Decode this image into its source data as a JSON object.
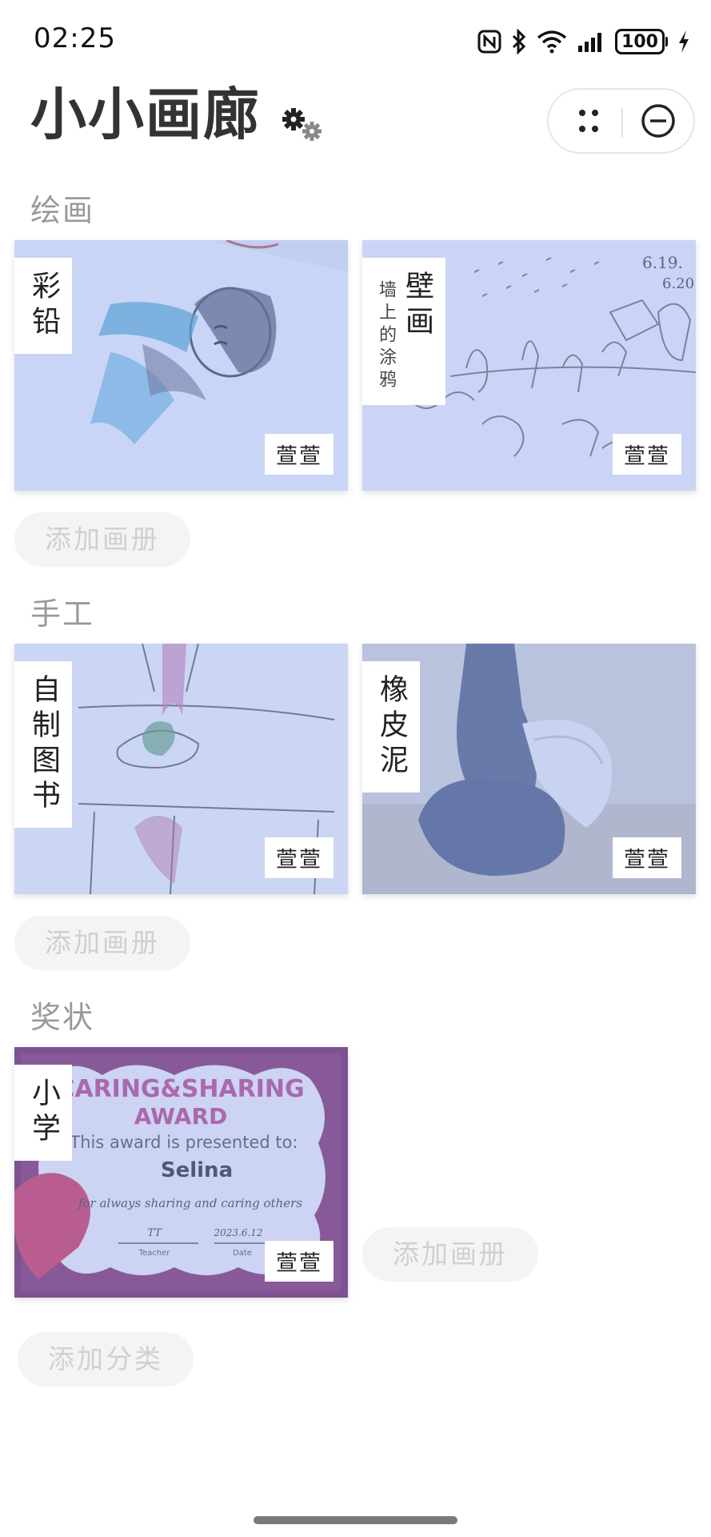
{
  "status": {
    "time": "02:25",
    "battery": "100"
  },
  "header": {
    "title": "小小画廊"
  },
  "sections": [
    {
      "title": "绘画",
      "add_label": "添加画册",
      "albums": [
        {
          "title": "彩铅",
          "subtitle": "",
          "owner": "萱萱"
        },
        {
          "title": "壁画",
          "subtitle": "墙上的涂鸦",
          "owner": "萱萱"
        }
      ]
    },
    {
      "title": "手工",
      "add_label": "添加画册",
      "albums": [
        {
          "title": "自制图书",
          "subtitle": "",
          "owner": "萱萱"
        },
        {
          "title": "橡皮泥",
          "subtitle": "",
          "owner": "萱萱"
        }
      ]
    },
    {
      "title": "奖状",
      "add_label": "添加画册",
      "albums": [
        {
          "title": "小学",
          "subtitle": "",
          "owner": "萱萱"
        }
      ]
    }
  ],
  "add_category_label": "添加分类",
  "certificate": {
    "heading1": "CARING&SHARING",
    "heading2": "AWARD",
    "line": "This award is presented to:",
    "name": "Selina",
    "reason": "for always sharing and caring others",
    "sign": "TT",
    "date": "2023.6.12",
    "teacher_label": "Teacher",
    "date_label": "Date"
  },
  "mural_note": {
    "line1": "6.19.",
    "line2": "6.20"
  },
  "icons": {
    "settings": "gears-icon",
    "menu": "more-dots-icon",
    "close": "close-circle-icon",
    "nfc": "nfc-icon",
    "bluetooth": "bluetooth-icon",
    "wifi": "wifi-icon",
    "signal": "signal-icon",
    "charging": "charging-bolt-icon"
  },
  "colors": {
    "tint": "#82a0f5",
    "title": "#333333",
    "section": "#999999",
    "add_text": "#d0d0d0"
  }
}
